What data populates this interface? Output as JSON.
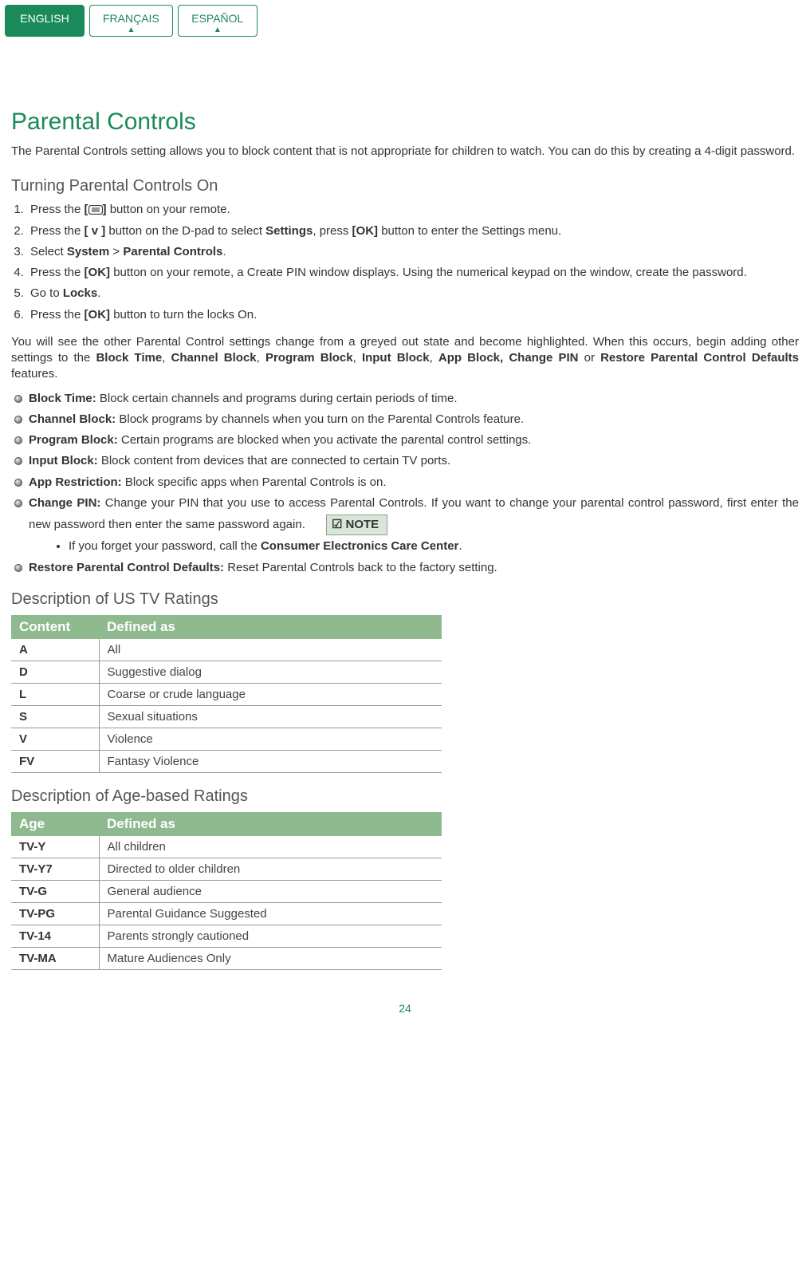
{
  "tabs": {
    "english": "ENGLISH",
    "francais": "FRANÇAIS",
    "espanol": "ESPAÑOL"
  },
  "title": "Parental Controls",
  "intro": "The Parental Controls setting allows you to block content that is not appropriate for children to watch. You can do this by creating a 4-digit password.",
  "section1_title": "Turning Parental Controls On",
  "steps": {
    "s1_a": "Press the ",
    "s1_b": "[",
    "s1_c": "]",
    "s1_d": " button on your remote.",
    "s2_a": "Press the ",
    "s2_b": "[ v ]",
    "s2_c": " button on the D-pad to select ",
    "s2_d": "Settings",
    "s2_e": ", press ",
    "s2_f": "[OK]",
    "s2_g": " button to enter the Settings menu.",
    "s3_a": "Select ",
    "s3_b": "System",
    "s3_c": " > ",
    "s3_d": "Parental Controls",
    "s3_e": ".",
    "s4_a": "Press the ",
    "s4_b": "[OK]",
    "s4_c": " button on your remote, a Create PIN window displays. Using the numerical keypad on the window, create the password.",
    "s5_a": "Go to ",
    "s5_b": "Locks",
    "s5_c": ".",
    "s6_a": "Press the ",
    "s6_b": "[OK]",
    "s6_c": " button to turn the locks On."
  },
  "follow_a": "You will see the other Parental Control settings change from a greyed out state and become highlighted. When this occurs, begin adding other settings to the ",
  "follow_b": "Block Time",
  "follow_c": ", ",
  "follow_d": "Channel Block",
  "follow_e": ", ",
  "follow_f": "Program Block",
  "follow_g": ", ",
  "follow_h": "Input Block",
  "follow_i": ", ",
  "follow_j": "App Block, Change PIN",
  "follow_k": " or ",
  "follow_l": "Restore Parental Control Defaults",
  "follow_m": " features.",
  "bullets": {
    "b1_t": "Block Time:",
    "b1_d": " Block certain channels and programs during certain periods of time.",
    "b2_t": "Channel Block:",
    "b2_d": " Block programs by channels when you turn on the Parental Controls feature.",
    "b3_t": "Program Block:",
    "b3_d": " Certain programs are blocked when you activate the parental control settings.",
    "b4_t": "Input Block:",
    "b4_d": " Block content from devices that are connected to certain TV ports.",
    "b5_t": "App Restriction:",
    "b5_d": " Block specific apps when Parental Controls is on.",
    "b6_t": "Change PIN:",
    "b6_d": " Change your PIN that you use to access Parental Controls. If you want to change your parental control password, first enter the new password then enter the same password again.",
    "b7_t": "Restore Parental Control Defaults:",
    "b7_d": " Reset Parental Controls back to the factory setting."
  },
  "note_label": "NOTE",
  "note_a": "If you forget your password, call the ",
  "note_b": "Consumer Electronics Care Center",
  "note_c": ".",
  "section2_title": "Description of US TV Ratings",
  "table1": {
    "h1": "Content",
    "h2": "Defined as",
    "rows": [
      {
        "c": "A",
        "d": "All"
      },
      {
        "c": "D",
        "d": "Suggestive dialog"
      },
      {
        "c": "L",
        "d": "Coarse or crude language"
      },
      {
        "c": "S",
        "d": "Sexual situations"
      },
      {
        "c": "V",
        "d": "Violence"
      },
      {
        "c": "FV",
        "d": "Fantasy Violence"
      }
    ]
  },
  "section3_title": "Description of Age-based Ratings",
  "table2": {
    "h1": "Age",
    "h2": "Defined as",
    "rows": [
      {
        "c": "TV-Y",
        "d": "All children"
      },
      {
        "c": "TV-Y7",
        "d": "Directed to older children"
      },
      {
        "c": "TV-G",
        "d": "General audience"
      },
      {
        "c": "TV-PG",
        "d": "Parental Guidance Suggested"
      },
      {
        "c": "TV-14",
        "d": "Parents strongly cautioned"
      },
      {
        "c": "TV-MA",
        "d": "Mature Audiences Only"
      }
    ]
  },
  "page_number": "24"
}
